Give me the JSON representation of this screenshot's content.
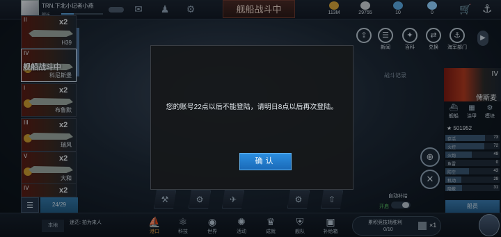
{
  "topbar": {
    "player_name": "TRN.下北小记者小燕",
    "rank_label": "舰长",
    "status_banner": "舰船战斗中",
    "resources": [
      {
        "icon": "gold-coin-icon",
        "value": "113M",
        "color": "#d4a33a"
      },
      {
        "icon": "oil-icon",
        "value": "29755",
        "color": "#c9cfd6"
      },
      {
        "icon": "gem-icon",
        "value": "10",
        "color": "#5aa8e0"
      },
      {
        "icon": "diamond-icon",
        "value": "0",
        "color": "#8fd0ff"
      }
    ]
  },
  "ship_list": {
    "count": "24/29",
    "selected_overlay": "舰船战斗中",
    "ships": [
      {
        "tier": "II",
        "mult": "x2",
        "name": "H39"
      },
      {
        "tier": "IV",
        "mult": "x2",
        "name": "科尼斯堡"
      },
      {
        "tier": "I",
        "mult": "x2",
        "name": "布鲁默"
      },
      {
        "tier": "III",
        "mult": "x2",
        "name": "瑞风"
      },
      {
        "tier": "V",
        "mult": "x2",
        "name": "大和"
      },
      {
        "tier": "IV",
        "mult": "x2",
        "name": ""
      }
    ]
  },
  "right_actions": [
    {
      "label": "",
      "icon": "share-icon"
    },
    {
      "label": "新闻",
      "icon": "news-icon"
    },
    {
      "label": "百科",
      "icon": "encyclopedia-icon"
    },
    {
      "label": "兑换",
      "icon": "exchange-icon"
    },
    {
      "label": "海军部门",
      "icon": "navy-icon"
    }
  ],
  "battle_record": "战斗记录",
  "detail": {
    "tier": "IV",
    "name": "俾斯麦",
    "tabs": [
      "舰船",
      "涂甲",
      "模块"
    ],
    "power": "501952",
    "stats": [
      {
        "name": "存活",
        "value": "73",
        "frac": 0.73
      },
      {
        "name": "火控",
        "value": "72",
        "frac": 0.72
      },
      {
        "name": "火炮",
        "value": "49",
        "frac": 0.49
      },
      {
        "name": "鱼雷",
        "value": "0",
        "frac": 0.0
      },
      {
        "name": "防空",
        "value": "43",
        "frac": 0.43
      },
      {
        "name": "机动",
        "value": "29",
        "frac": 0.29
      },
      {
        "name": "隐蔽",
        "value": "31",
        "frac": 0.31
      }
    ],
    "crew_button": "船员"
  },
  "auto_fill": {
    "label": "自动补给",
    "state": "开启",
    "on": true
  },
  "modal": {
    "message": "您的账号22点以后不能登陆，请明日8点以后再次登陆。",
    "confirm": "确认"
  },
  "bottom": {
    "channel": "本地",
    "chat": "迷茫: 拍为来人",
    "nav": [
      {
        "label": "港口",
        "icon": "port-icon",
        "active": true
      },
      {
        "label": "科技",
        "icon": "tech-icon",
        "active": false
      },
      {
        "label": "世界",
        "icon": "world-icon",
        "active": false
      },
      {
        "label": "活动",
        "icon": "event-icon",
        "active": false
      },
      {
        "label": "成就",
        "icon": "achievement-icon",
        "active": false
      },
      {
        "label": "舰队",
        "icon": "fleet-icon",
        "active": false
      },
      {
        "label": "补给箱",
        "icon": "supply-box-icon",
        "active": false
      }
    ],
    "arena": {
      "title": "累积竞技场胜利",
      "progress": "0/10",
      "reward_count": "×1"
    }
  }
}
